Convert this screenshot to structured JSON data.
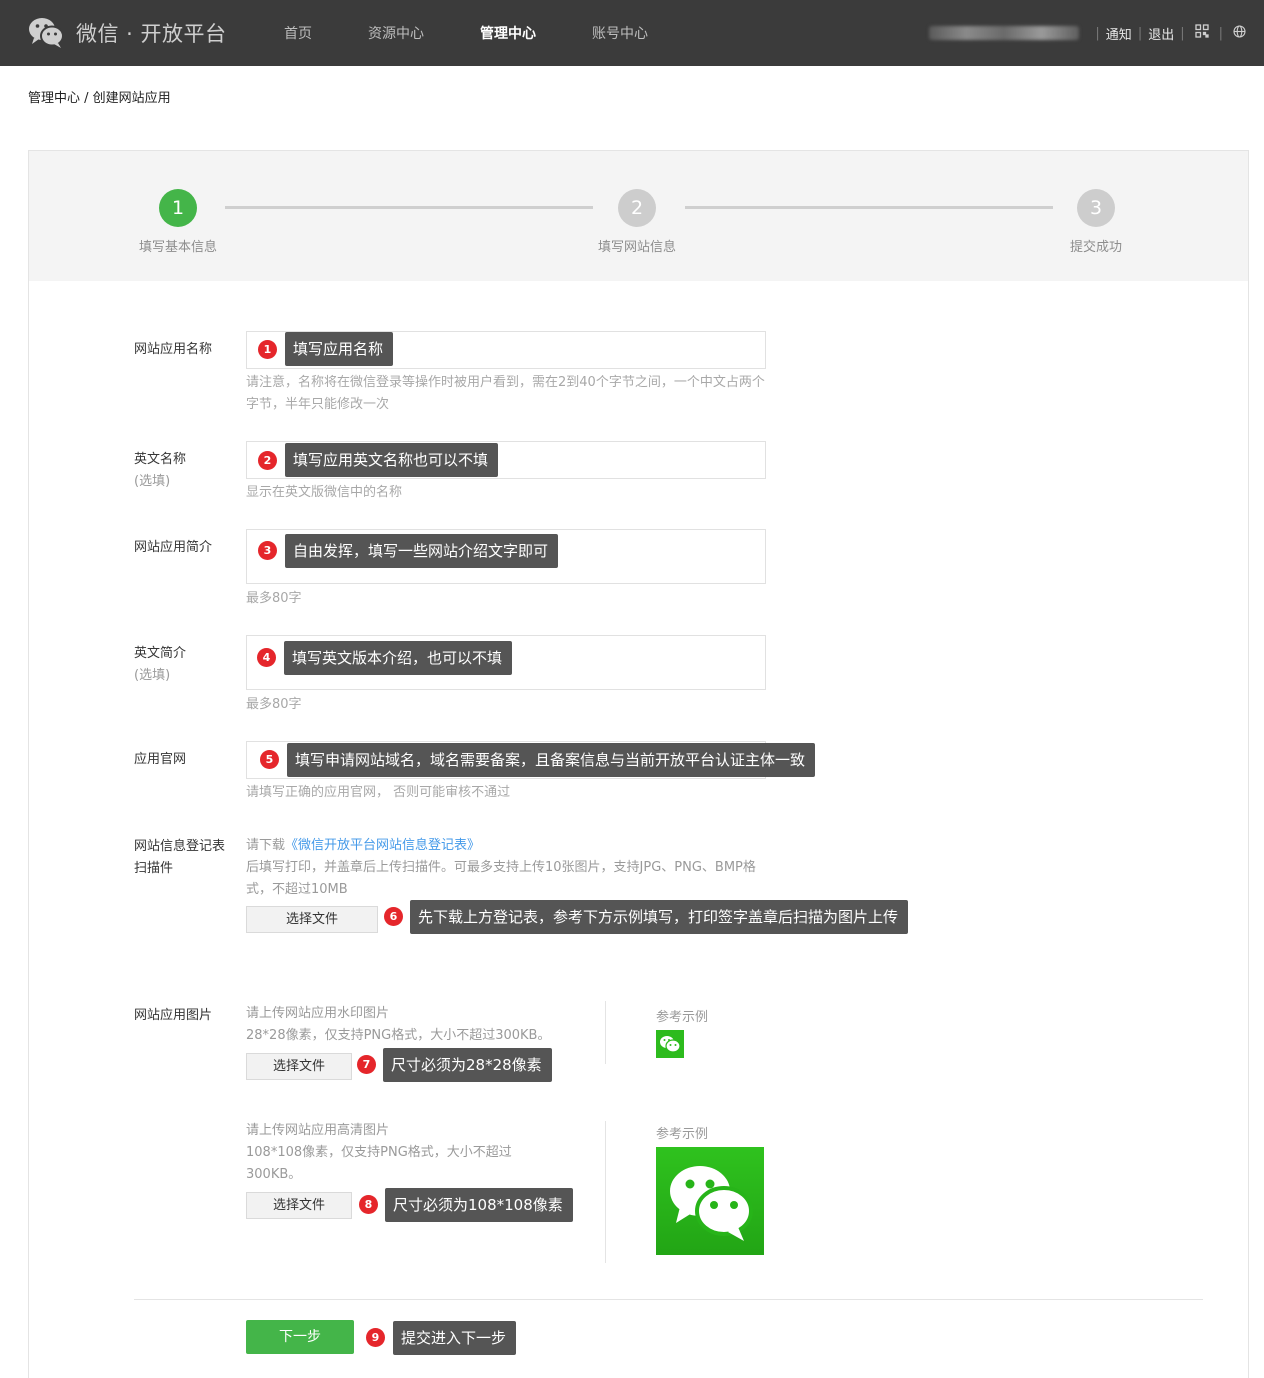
{
  "header": {
    "logo_text": "微信 · 开放平台",
    "nav": [
      "首页",
      "资源中心",
      "管理中心",
      "账号中心"
    ],
    "active_nav": "管理中心",
    "right_links": [
      "通知",
      "退出"
    ],
    "icons": [
      "qrcode-icon",
      "globe-icon"
    ]
  },
  "breadcrumb": "管理中心 / 创建网站应用",
  "steps": [
    {
      "number": "1",
      "label": "填写基本信息",
      "state": "done"
    },
    {
      "number": "2",
      "label": "填写网站信息",
      "state": "todo"
    },
    {
      "number": "3",
      "label": "提交成功",
      "state": "todo"
    }
  ],
  "form": {
    "app_name": {
      "label": "网站应用名称",
      "hint": "请注意，名称将在微信登录等操作时被用户看到，需在2到40个字节之间，一个中文占两个字节，半年只能修改一次",
      "tip_num": "1",
      "tip": "填写应用名称"
    },
    "en_name": {
      "label": "英文名称",
      "optional": "(选填)",
      "hint": "显示在英文版微信中的名称",
      "tip_num": "2",
      "tip": "填写应用英文名称也可以不填"
    },
    "intro": {
      "label": "网站应用简介",
      "hint": "最多80字",
      "tip_num": "3",
      "tip": "自由发挥，填写一些网站介绍文字即可"
    },
    "en_intro": {
      "label": "英文简介",
      "optional": "(选填)",
      "hint": "最多80字",
      "tip_num": "4",
      "tip": "填写英文版本介绍，也可以不填"
    },
    "website": {
      "label": "应用官网",
      "hint": "请填写正确的应用官网， 否则可能审核不通过",
      "tip_num": "5",
      "tip": "填写申请网站域名，域名需要备案，且备案信息与当前开放平台认证主体一致"
    },
    "register_form": {
      "label_line1": "网站信息登记表",
      "label_line2": "扫描件",
      "hint_prefix": "请下载",
      "hint_link": "《微信开放平台网站信息登记表》",
      "hint_rest": "后填写打印，并盖章后上传扫描件。可最多支持上传10张图片，支持JPG、PNG、BMP格式，不超过10MB",
      "button": "选择文件",
      "tip_num": "6",
      "tip": "先下载上方登记表，参考下方示例填写，打印签字盖章后扫描为图片上传"
    },
    "app_image": {
      "label": "网站应用图片",
      "small": {
        "title": "请上传网站应用水印图片",
        "desc": "28*28像素，仅支持PNG格式，大小不超过300KB。",
        "button": "选择文件",
        "tip_num": "7",
        "tip": "尺寸必须为28*28像素",
        "ref_title": "参考示例"
      },
      "large": {
        "title": "请上传网站应用高清图片",
        "desc": "108*108像素，仅支持PNG格式，大小不超过300KB。",
        "button": "选择文件",
        "tip_num": "8",
        "tip": "尺寸必须为108*108像素",
        "ref_title": "参考示例"
      }
    },
    "next": {
      "button": "下一步",
      "tip_num": "9",
      "tip": "提交进入下一步"
    }
  },
  "colors": {
    "header_bg": "#3b3b3b",
    "accent_green": "#44b549",
    "badge_red": "#e5262b",
    "tip_bg": "#555555",
    "link_blue": "#459ae9"
  }
}
